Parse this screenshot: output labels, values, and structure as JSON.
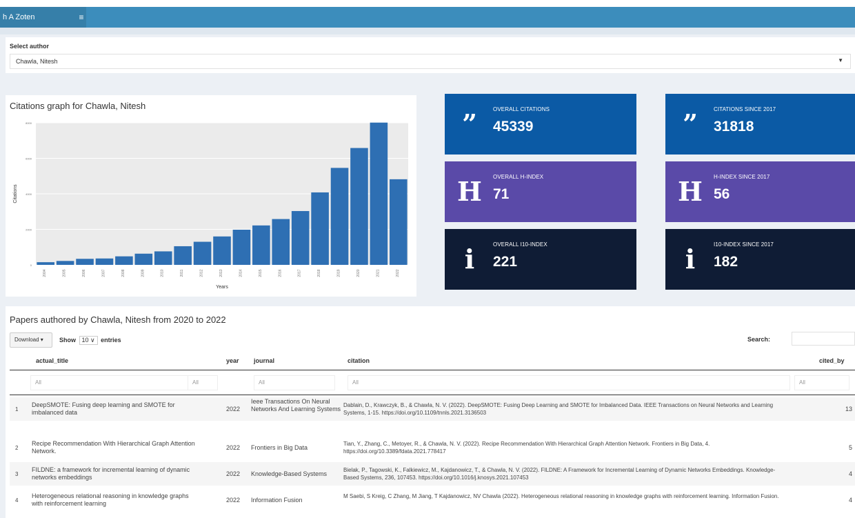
{
  "header": {
    "app_title": "h A Zoten",
    "toggle_icon": "hamburger-icon"
  },
  "author_select": {
    "label": "Select author",
    "value": "Chawla, Nitesh"
  },
  "chart": {
    "title": "Citations graph for Chawla, Nitesh"
  },
  "chart_data": {
    "type": "bar",
    "title": "Citations graph for Chawla, Nitesh",
    "xlabel": "Years",
    "ylabel": "Citations",
    "bar_color": "#2e6fb3",
    "background": "#ebebeb",
    "grid": true,
    "ylim": [
      0,
      8000
    ],
    "yticks": [
      "0",
      "2000",
      "4000",
      "6000",
      "8000"
    ],
    "categories": [
      "2004",
      "2005",
      "2006",
      "2007",
      "2008",
      "2009",
      "2010",
      "2011",
      "2012",
      "2013",
      "2014",
      "2015",
      "2016",
      "2017",
      "2018",
      "2019",
      "2020",
      "2021",
      "2022"
    ],
    "values": [
      150,
      220,
      340,
      360,
      480,
      630,
      760,
      1050,
      1300,
      1600,
      1980,
      2220,
      2580,
      3030,
      4080,
      5460,
      6580,
      8010,
      4820
    ]
  },
  "stats": [
    {
      "label": "OVERALL CITATIONS",
      "value": "45339",
      "icon": "quote-icon",
      "glyph": "”",
      "color": "#0b5aa5"
    },
    {
      "label": "CITATIONS SINCE 2017",
      "value": "31818",
      "icon": "quote-icon",
      "glyph": "”",
      "color": "#0b5aa5"
    },
    {
      "label": "OVERALL H-INDEX",
      "value": "71",
      "icon": "h-letter-icon",
      "glyph": "H",
      "color": "#5a4aa8"
    },
    {
      "label": "H-INDEX SINCE 2017",
      "value": "56",
      "icon": "h-letter-icon",
      "glyph": "H",
      "color": "#5a4aa8"
    },
    {
      "label": "OVERALL I10-INDEX",
      "value": "221",
      "icon": "info-icon",
      "glyph": "i",
      "color": "#0f1c35"
    },
    {
      "label": "I10-INDEX SINCE 2017",
      "value": "182",
      "icon": "info-icon",
      "glyph": "i",
      "color": "#0f1c35"
    }
  ],
  "papers": {
    "title": "Papers authored by Chawla, Nitesh from 2020 to 2022",
    "download_label": "Download",
    "show_label": "Show",
    "entries_value": "10",
    "entries_label": "entries",
    "search_label": "Search:",
    "columns": [
      "actual_title",
      "year",
      "journal",
      "citation",
      "cited_by"
    ],
    "filter_placeholder": "All",
    "rows": [
      {
        "idx": "1",
        "title": "DeepSMOTE: Fusing deep learning and SMOTE for imbalanced data",
        "year": "2022",
        "journal": "Ieee Transactions On Neural Networks And Learning Systems",
        "citation": "Dablain, D., Krawczyk, B., & Chawla, N. V. (2022). DeepSMOTE: Fusing Deep Learning and SMOTE for Imbalanced Data. IEEE Transactions on Neural Networks and Learning Systems, 1-15. https://doi.org/10.1109/tnnls.2021.3136503",
        "cited_by": "13"
      },
      {
        "idx": "2",
        "title": "Recipe Recommendation With Hierarchical Graph Attention Network.",
        "year": "2022",
        "journal": "Frontiers in Big Data",
        "citation": "Tian, Y., Zhang, C., Metoyer, R., & Chawla, N. V. (2022). Recipe Recommendation With Hierarchical Graph Attention Network. Frontiers in Big Data, 4. https://doi.org/10.3389/fdata.2021.778417",
        "cited_by": "5"
      },
      {
        "idx": "3",
        "title": "FILDNE: a framework for incremental learning of dynamic networks embeddings",
        "year": "2022",
        "journal": "Knowledge-Based Systems",
        "citation": "Bielak, P., Tagowski, K., Falkiewicz, M., Kajdanowicz, T., & Chawla, N. V. (2022). FILDNE: A Framework for Incremental Learning of Dynamic Networks Embeddings. Knowledge-Based Systems, 236, 107453. https://doi.org/10.1016/j.knosys.2021.107453",
        "cited_by": "4"
      },
      {
        "idx": "4",
        "title": "Heterogeneous relational reasoning in knowledge graphs with reinforcement learning",
        "year": "2022",
        "journal": "Information Fusion",
        "citation": "M Saebi, S Kreig, C Zhang, M Jiang, T Kajdanowicz, NV Chawla (2022). Heterogeneous relational reasoning in knowledge graphs with reinforcement learning. Information Fusion.",
        "cited_by": "4"
      }
    ]
  }
}
